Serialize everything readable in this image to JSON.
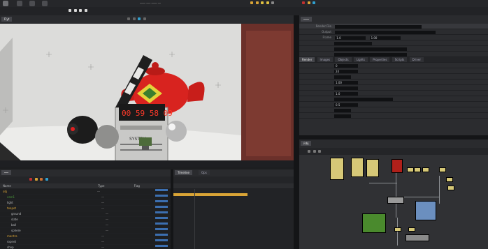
{
  "topbar": {
    "icons": [
      "menu-icon",
      "file-icon",
      "edit-icon",
      "render-icon",
      "window-icon",
      "help-icon"
    ],
    "time_icons": [
      "clock-icon",
      "gear-icon",
      "light-icon",
      "bulb-icon",
      "camera-icon"
    ]
  },
  "viewport": {
    "tab_label": "Flyt",
    "scene_screen": "00 59 58 09",
    "scene_slate": "SYSTEM"
  },
  "param_panel": {
    "title_fields": [
      "Render File",
      "Output",
      "Frame"
    ],
    "tabs": [
      "Render",
      "Images",
      "Objects",
      "Lights",
      "Properties",
      "Scripts",
      "Driver"
    ],
    "values": [
      "1.0",
      "1.00",
      "0",
      "24",
      "1.00",
      "1.0",
      "0.5"
    ]
  },
  "tree_panel": {
    "headers": [
      "Name",
      "Type",
      "Flag"
    ],
    "rows": [
      "obj",
      "cam1",
      "light",
      "teapot",
      "ground",
      "slate",
      "ball",
      "sphere",
      "mantra",
      "ropnet",
      "shop",
      "mat"
    ]
  },
  "timeline_panel": {
    "tabs": [
      "Timeline",
      "Ops"
    ]
  },
  "network": {
    "tab_label": "/obj",
    "nodes": 16
  },
  "colors": {
    "accent": "#d9a436",
    "teapot": "#d8231f",
    "node_yellow": "#d6c877",
    "node_green": "#4a8a2d",
    "node_blue": "#6b8fbf",
    "node_red": "#b0201a"
  }
}
